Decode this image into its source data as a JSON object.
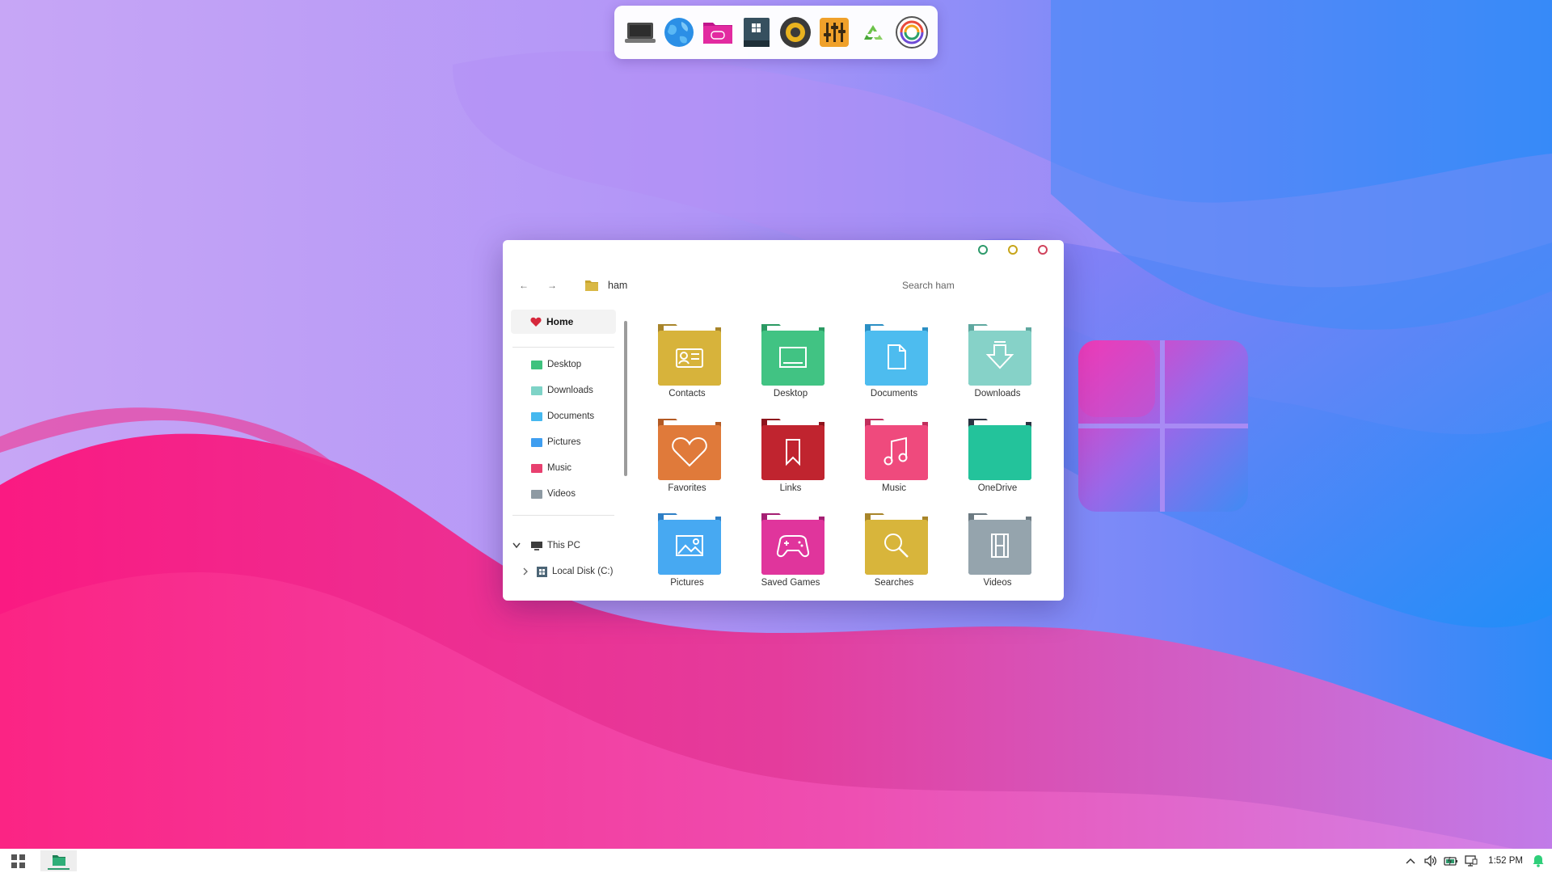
{
  "colors": {
    "accent_green": "#2f9b6e",
    "wallpaper_top": "#c09cf7",
    "wallpaper_blue": "#2f8cf8",
    "wallpaper_pink": "#fb1f84"
  },
  "dock": {
    "items": [
      {
        "name": "laptop-icon"
      },
      {
        "name": "globe-icon"
      },
      {
        "name": "games-folder-icon"
      },
      {
        "name": "windows-terminal-icon"
      },
      {
        "name": "speaker-icon"
      },
      {
        "name": "equalizer-icon"
      },
      {
        "name": "recycle-bin-icon"
      },
      {
        "name": "spiral-app-icon"
      }
    ]
  },
  "explorer": {
    "path": "ham",
    "search_placeholder": "Search ham",
    "nav_back": "←",
    "nav_forward": "→",
    "sidebar": {
      "home": "Home",
      "items": [
        {
          "label": "Desktop",
          "color": "#3fc27e"
        },
        {
          "label": "Downloads",
          "color": "#7ed3c7"
        },
        {
          "label": "Documents",
          "color": "#45b8ef"
        },
        {
          "label": "Pictures",
          "color": "#3f9ef0"
        },
        {
          "label": "Music",
          "color": "#e8406f"
        },
        {
          "label": "Videos",
          "color": "#8e9aa3"
        }
      ],
      "this_pc": "This PC",
      "local_disk": "Local Disk (C:)"
    },
    "folders": [
      {
        "label": "Contacts",
        "color": "#d7b33b",
        "icon": "contact-card-icon"
      },
      {
        "label": "Desktop",
        "color": "#41c383",
        "icon": "monitor-icon"
      },
      {
        "label": "Documents",
        "color": "#4dbcef",
        "icon": "document-icon"
      },
      {
        "label": "Downloads",
        "color": "#86d2c8",
        "icon": "download-icon"
      },
      {
        "label": "Favorites",
        "color": "#e07a3a",
        "icon": "heart-icon"
      },
      {
        "label": "Links",
        "color": "#c0242f",
        "icon": "bookmark-icon"
      },
      {
        "label": "Music",
        "color": "#ef4a7d",
        "icon": "music-note-icon"
      },
      {
        "label": "OneDrive",
        "color": "#23c39b",
        "icon": "cloud-folder-icon"
      },
      {
        "label": "Pictures",
        "color": "#47a9f2",
        "icon": "image-icon"
      },
      {
        "label": "Saved Games",
        "color": "#e0359c",
        "icon": "gamepad-icon"
      },
      {
        "label": "Searches",
        "color": "#d8b53b",
        "icon": "magnifier-icon"
      },
      {
        "label": "Videos",
        "color": "#95a4ad",
        "icon": "film-icon"
      }
    ]
  },
  "taskbar": {
    "time": "1:52 PM"
  }
}
